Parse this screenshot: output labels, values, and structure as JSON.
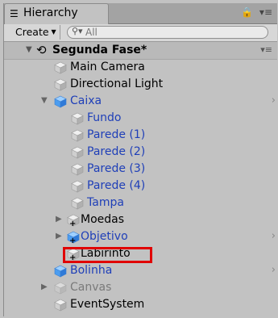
{
  "tab": {
    "icon": "hierarchy-list-icon",
    "label": "Hierarchy"
  },
  "toolbar": {
    "create_label": "Create",
    "search_placeholder": "All"
  },
  "scene": {
    "name": "Segunda Fase*"
  },
  "rows": [
    {
      "label": "Main Camera",
      "style": "normal"
    },
    {
      "label": "Directional Light",
      "style": "normal"
    },
    {
      "label": "Caixa",
      "style": "blue",
      "expanded": true
    },
    {
      "label": "Fundo",
      "style": "blue"
    },
    {
      "label": "Parede (1)",
      "style": "blue"
    },
    {
      "label": "Parede (2)",
      "style": "blue"
    },
    {
      "label": "Parede (3)",
      "style": "blue"
    },
    {
      "label": "Parede (4)",
      "style": "blue"
    },
    {
      "label": "Tampa",
      "style": "blue"
    },
    {
      "label": "Moedas",
      "style": "normal",
      "expanded": false
    },
    {
      "label": "Objetivo",
      "style": "blue",
      "expanded": false
    },
    {
      "label": "Labirinto",
      "style": "normal",
      "highlighted": true
    },
    {
      "label": "Bolinha",
      "style": "blue"
    },
    {
      "label": "Canvas",
      "style": "grey",
      "expanded": false
    },
    {
      "label": "EventSystem",
      "style": "normal"
    }
  ],
  "colors": {
    "prefab_blue": "#1f3fb8",
    "highlight_red": "#e00000",
    "inactive_grey": "#7a7a7a"
  }
}
